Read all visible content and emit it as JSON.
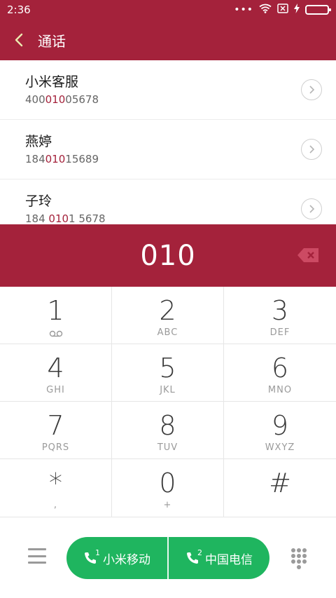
{
  "status_bar": {
    "time": "2:36",
    "dots": "•••",
    "battery_level": 1.0
  },
  "header": {
    "title": "通话"
  },
  "results": [
    {
      "name": "小米客服",
      "number_prefix": "400",
      "number_match": "010",
      "number_suffix": "05678"
    },
    {
      "name": "燕婷",
      "number_prefix": "184",
      "number_match": "010",
      "number_suffix": "15689"
    },
    {
      "name": "子玲",
      "number_prefix": "184 ",
      "number_match": "010",
      "number_suffix": "1 5678"
    }
  ],
  "display": {
    "digits": "010"
  },
  "keypad": [
    {
      "digit": "1",
      "letters": "",
      "sub_icon": "voicemail-icon"
    },
    {
      "digit": "2",
      "letters": "ABC"
    },
    {
      "digit": "3",
      "letters": "DEF"
    },
    {
      "digit": "4",
      "letters": "GHI"
    },
    {
      "digit": "5",
      "letters": "JKL"
    },
    {
      "digit": "6",
      "letters": "MNO"
    },
    {
      "digit": "7",
      "letters": "PQRS"
    },
    {
      "digit": "8",
      "letters": "TUV"
    },
    {
      "digit": "9",
      "letters": "WXYZ"
    },
    {
      "digit": "*",
      "letters": ","
    },
    {
      "digit": "0",
      "letters": "+"
    },
    {
      "digit": "#",
      "letters": ""
    }
  ],
  "call_buttons": [
    {
      "label": "小米移动",
      "slot": "1"
    },
    {
      "label": "中国电信",
      "slot": "2"
    }
  ],
  "colors": {
    "brand": "#a4223b",
    "call_green": "#1fb55f",
    "battery_green": "#4ccd5b"
  }
}
